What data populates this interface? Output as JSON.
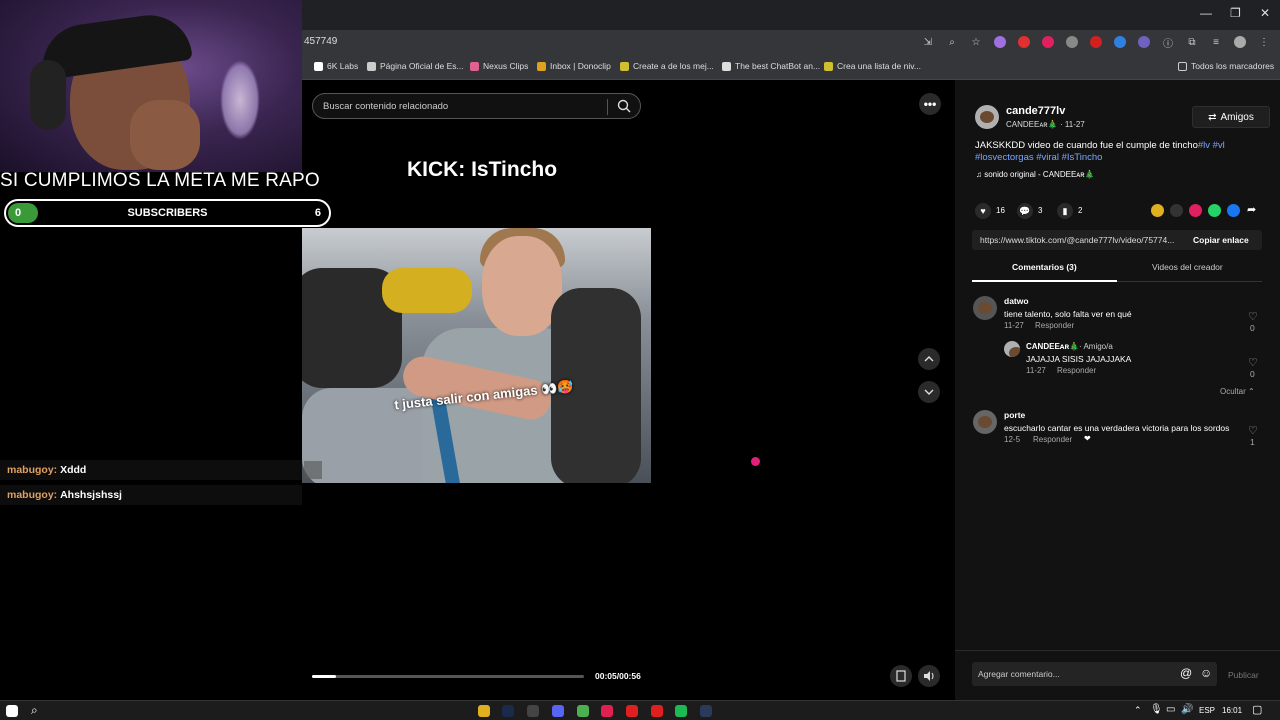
{
  "browser": {
    "url": "457749",
    "window_controls": [
      "—",
      "❐",
      "✕"
    ],
    "bookmarks": [
      "6K Labs",
      "Página Oficial de Es...",
      "Nexus Clips",
      "Inbox | Donoclip",
      "Create a de los mej...",
      "The best ChatBot an...",
      "Crea una lista de niv..."
    ],
    "bookmarks_folder": "Todos los marcadores"
  },
  "stream": {
    "goal_text": "SI CUMPLIMOS LA META ME RAPO",
    "sub_current": "0",
    "sub_label": "SUBSCRIBERS",
    "sub_target": "6",
    "sub_progress": 0.0,
    "chat": [
      {
        "user": "mabugoy:",
        "message": "Xddd"
      },
      {
        "user": "mabugoy:",
        "message": "Ahshsjshssj"
      }
    ]
  },
  "player": {
    "search_placeholder": "Buscar contenido relacionado",
    "title": "KICK: IsTincho",
    "caption": "t justa salir con amigas 👀🥵",
    "time": "00:05/00:56",
    "progress": 0.09
  },
  "post": {
    "username": "cande777lv",
    "display_name": "CANDEEᴀʀ🎄",
    "date": "11-27",
    "follow_label": "Amigos",
    "description": "JAKSKKDD video de cuando fue el cumple de tincho",
    "hashtags_line1": "#lv #vl",
    "hashtags_line2": "#losvectorgas #viral #IsTincho",
    "sound": "sonido original - CANDEEᴀʀ🎄",
    "likes": "16",
    "comments_count": "3",
    "saves": "2",
    "link": "https://www.tiktok.com/@cande777lv/video/75774...",
    "copy_label": "Copiar enlace",
    "tab_comments": "Comentarios (3)",
    "tab_creator": "Videos del creador",
    "comments": [
      {
        "user": "datwo",
        "text": "tiene talento, solo falta ver en qué",
        "date": "11-27",
        "reply": "Responder",
        "likes": "0"
      },
      {
        "user": "CANDEEᴀʀ🎄",
        "badge": "· Amigo/a",
        "text": "JAJAJJA SISIS JAJAJJAKA",
        "date": "11-27",
        "reply": "Responder",
        "likes": "0"
      },
      {
        "user": "porte",
        "text": "escucharlo cantar es una verdadera victoria para los sordos",
        "date": "12-5",
        "reply": "Responder",
        "likes": "1"
      }
    ],
    "hide_label": "Ocultar",
    "comment_placeholder": "Agregar comentario...",
    "publish_label": "Publicar"
  },
  "taskbar": {
    "lang": "ESP",
    "clock": "16:01"
  },
  "colors": {
    "accent_green": "#3a9a3a",
    "hashtag_blue": "#7aa7ff",
    "cursor_pink": "#e0207a"
  }
}
